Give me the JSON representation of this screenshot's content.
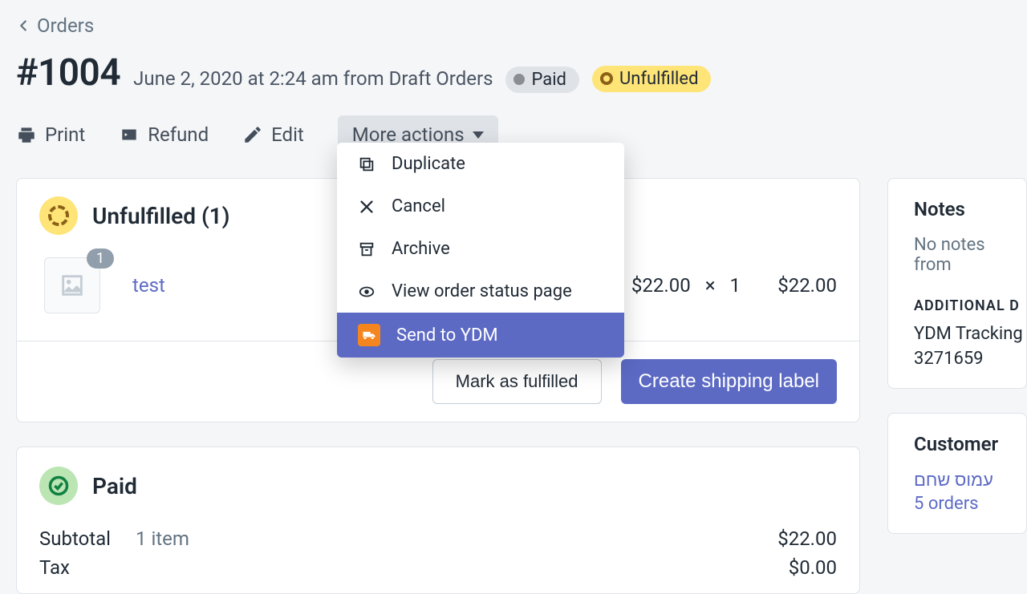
{
  "breadcrumb": {
    "label": "Orders"
  },
  "header": {
    "title": "#1004",
    "meta": "June 2, 2020 at 2:24 am from Draft Orders",
    "paid_badge": "Paid",
    "unfulfilled_badge": "Unfulfilled"
  },
  "toolbar": {
    "print": "Print",
    "refund": "Refund",
    "edit": "Edit",
    "more": "More actions"
  },
  "dropdown": {
    "duplicate": "Duplicate",
    "cancel": "Cancel",
    "archive": "Archive",
    "view_status": "View order status page",
    "send_ydm": "Send to YDM"
  },
  "unfulfilled": {
    "heading": "Unfulfilled (1)",
    "item": {
      "qty_badge": "1",
      "name": "test",
      "unit_price": "$22.00",
      "times": "×",
      "qty": "1",
      "total": "$22.00"
    },
    "mark_fulfilled": "Mark as fulfilled",
    "create_label": "Create shipping label"
  },
  "paid": {
    "heading": "Paid",
    "subtotal_label": "Subtotal",
    "subtotal_items": "1 item",
    "subtotal_value": "$22.00",
    "tax_label": "Tax",
    "tax_value": "$0.00"
  },
  "notes": {
    "heading": "Notes",
    "empty": "No notes from",
    "additional_label": "ADDITIONAL D",
    "tracking_label": "YDM Tracking",
    "tracking_number": "3271659"
  },
  "customer": {
    "heading": "Customer",
    "name": "עמוס שחם",
    "orders": "5 orders"
  }
}
